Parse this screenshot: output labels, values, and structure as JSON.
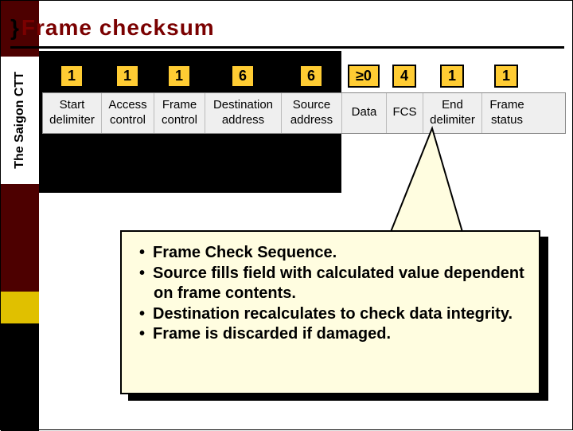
{
  "sidebar": {
    "label": "The Saigon CTT"
  },
  "title": {
    "brace": "}",
    "text": "Frame checksum"
  },
  "frame": {
    "columns": [
      {
        "bytes": "1",
        "label": "Start delimiter",
        "w": 74
      },
      {
        "bytes": "1",
        "label": "Access control",
        "w": 66
      },
      {
        "bytes": "1",
        "label": "Frame control",
        "w": 64
      },
      {
        "bytes": "6",
        "label": "Destination address",
        "w": 96
      },
      {
        "bytes": "6",
        "label": "Source address",
        "w": 76
      },
      {
        "bytes": "≥0",
        "label": "Data",
        "w": 56
      },
      {
        "bytes": "4",
        "label": "FCS",
        "w": 46
      },
      {
        "bytes": "1",
        "label": "End delimiter",
        "w": 74
      },
      {
        "bytes": "1",
        "label": "Frame status",
        "w": 62
      }
    ]
  },
  "callout": {
    "bullets": [
      "Frame Check Sequence.",
      "Source fills field with calculated value dependent on frame contents.",
      "Destination recalculates to check data integrity.",
      "Frame is discarded if damaged."
    ]
  }
}
